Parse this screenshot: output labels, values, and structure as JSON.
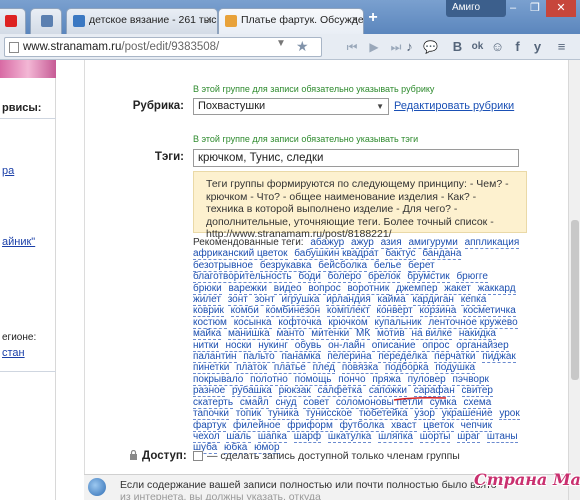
{
  "browser": {
    "tabs": [
      {
        "label": "детское вязание - 261 тыс."
      },
      {
        "label": "Платье фартук. Обсужден"
      }
    ],
    "profile_name": "Амиго",
    "win_buttons": [
      "–",
      "❐",
      "✕"
    ],
    "address": {
      "host": "www.stranamam.ru",
      "path": "/post/edit/9383508/"
    },
    "extensions": [
      "♪",
      "B",
      "ok",
      "f",
      "y"
    ]
  },
  "left": {
    "services_label": "рвисы:",
    "link1": "ра",
    "link2": "айник\"",
    "region_label": "егионе:",
    "region_link": "стан"
  },
  "form": {
    "rubric_hint": "В этой группе для записи обязательно указывать рубрику",
    "rubric_label": "Рубрика:",
    "rubric_value": "Похвастушки",
    "edit_rubrics": "Редактировать рубрики",
    "tags_hint": "В этой группе для записи обязательно указывать тэги",
    "tags_label": "Тэги:",
    "tags_value": "крючком, Тунис, следки",
    "info_text": "Теги группы формируются по следующему принципу: - Чем? - крючком - Что? - общее наименование изделия - Как? - техника в которой выполнено изделие - Для чего? - дополнительные, уточняющие теги. Более точный список - http://www.stranamam.ru/post/8188221/",
    "recommended_intro": "Рекомендованные теги:",
    "recommended_tags": [
      "абажур",
      "ажур",
      "азия",
      "амигуруми",
      "аппликация",
      "африканский цветок",
      "бабушкин квадрат",
      "бактус",
      "бандана",
      "безотрывное",
      "безрукавка",
      "бейсболка",
      "белье",
      "берет",
      "благотворительность",
      "боди",
      "болеро",
      "брелок",
      "брумстик",
      "брюгге",
      "брюки",
      "варежки",
      "видео",
      "вопрос",
      "воротник",
      "джемпер",
      "жакет",
      "жаккард",
      "жилет",
      "зонт",
      "зонт",
      "игрушка",
      "ирландия",
      "кайма",
      "кардиган",
      "кепка",
      "коврик",
      "комби",
      "комбинезон",
      "комплект",
      "конверт",
      "корзина",
      "косметичка",
      "костюм",
      "косынка",
      "кофточка",
      "крючком",
      "купальник",
      "ленточное кружево",
      "майка",
      "манишка",
      "манто",
      "митенки",
      "МК",
      "мотив",
      "на вилке",
      "накидка",
      "нитки",
      "носки",
      "нукинг",
      "обувь",
      "он-лайн",
      "описание",
      "опрос",
      "органайзер",
      "палантин",
      "пальто",
      "панамка",
      "пелерина",
      "переделка",
      "перчатки",
      "пиджак",
      "пинетки",
      "платок",
      "платье",
      "плед",
      "повязка",
      "подборка",
      "подушка",
      "покрывало",
      "полотно",
      "помощь",
      "пончо",
      "пряжа",
      "пуловер",
      "пэчворк",
      "разное",
      "рубашка",
      "рюкзак",
      "салфетка",
      "сапожки",
      "сарафан",
      "свитер",
      "скатерть",
      "смайл",
      "снуд",
      "совет",
      "соломоновы петли",
      "сумка",
      "схема",
      "тапочки",
      "топик",
      "туника",
      "тунисское",
      "тюбетейка",
      "узор",
      "украшение",
      "урок",
      "фартук",
      "филейное",
      "фриформ",
      "футболка",
      "хваст",
      "цветок",
      "чепчик",
      "чехол",
      "шаль",
      "шапка",
      "шарф",
      "шкатулка",
      "шляпка",
      "шорты",
      "шраг",
      "штаны",
      "шуба",
      "юбка",
      "юмор"
    ],
    "access_label": "Доступ:",
    "access_text": "— сделать запись доступной только членам группы"
  },
  "bottom_notice": {
    "line1": "Если содержание вашей записи полностью или почти полностью было взято",
    "line2": "из интернета, вы должны указать, откуда"
  },
  "watermark": "Страна Мам"
}
